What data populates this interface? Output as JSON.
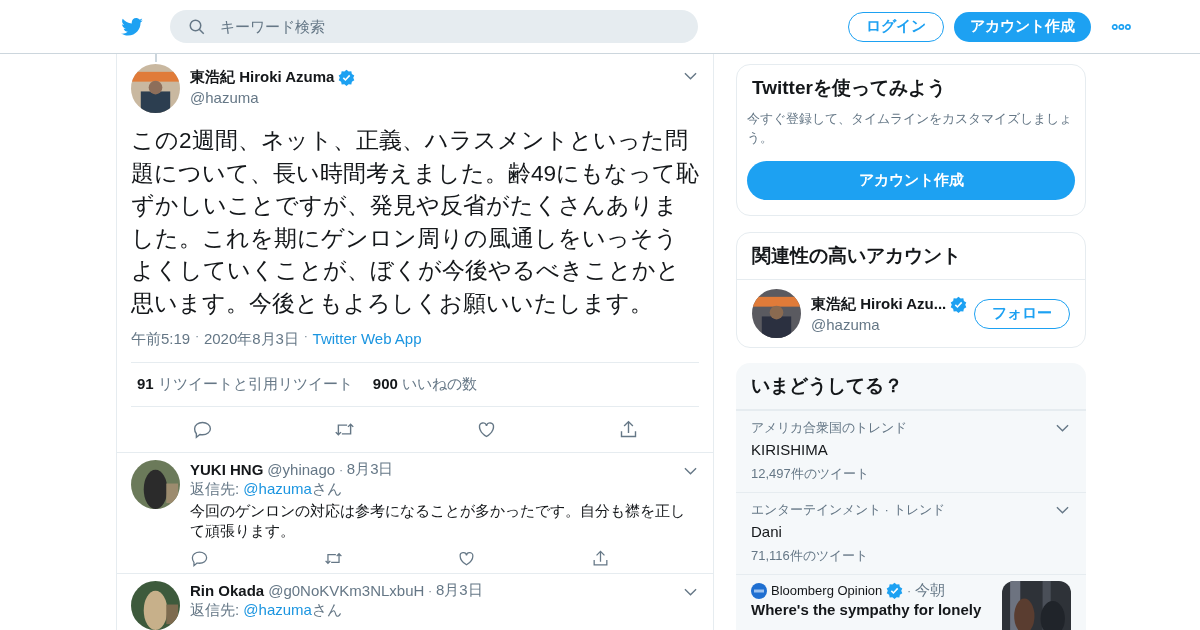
{
  "header": {
    "search": {
      "placeholder": "キーワード検索"
    },
    "login": "ログイン",
    "signup": "アカウント作成"
  },
  "tweet": {
    "author": {
      "name": "東浩紀 Hiroki Azuma",
      "handle": "@hazuma",
      "verified": true
    },
    "text": "この2週間、ネット、正義、ハラスメントといった問題について、長い時間考えました。齢49にもなって恥ずかしいことですが、発見や反省がたくさんありました。これを期にゲンロン周りの風通しをいっそうよくしていくことが、ぼくが今後やるべきことかと思います。今後ともよろしくお願いいたします。",
    "meta": [
      "午前5:19",
      "2020年8月3日"
    ],
    "separator": "·",
    "source": "Twitter Web App",
    "stats": [
      {
        "count": "91",
        "label": "リツイートと引用リツイート"
      },
      {
        "count": "900",
        "label": "いいねの数"
      }
    ]
  },
  "replies": [
    {
      "name": "YUKI HNG",
      "handle": "@yhinago",
      "separator": "·",
      "date": "8月3日",
      "reply_prefix": "返信先: ",
      "reply_to": "@hazuma",
      "reply_suffix": "さん",
      "text": "今回のゲンロンの対応は参考になることが多かったです。自分も襟を正して頑張ります。"
    },
    {
      "name": "Rin Okada",
      "handle": "@g0NoKVKm3NLxbuH",
      "separator": "·",
      "date": "8月3日",
      "reply_prefix": "返信先: ",
      "reply_to": "@hazuma",
      "reply_suffix": "さん"
    }
  ],
  "sidebar": {
    "signup_card": {
      "title": "Twitterを使ってみよう",
      "text": "今すぐ登録して、タイムラインをカスタマイズしましょう。",
      "button": "アカウント作成"
    },
    "related": {
      "title": "関連性の高いアカウント",
      "accounts": [
        {
          "name": "東浩紀 Hiroki Azu...",
          "handle": "@hazuma",
          "verified": true,
          "button": "フォロー"
        }
      ]
    },
    "trends": {
      "title": "いまどうしてる？",
      "items": [
        {
          "context": "アメリカ合衆国のトレンド",
          "name": "KIRISHIMA",
          "count": "12,497件のツイート"
        },
        {
          "context": "エンターテインメント · トレンド",
          "name": "Dani",
          "count": "71,116件のツイート"
        }
      ],
      "news": {
        "source": "Bloomberg Opinion",
        "verified": true,
        "separator": "·",
        "time": "今朝",
        "headline": "Where's the sympathy for lonely",
        "kind": "picture"
      }
    }
  }
}
